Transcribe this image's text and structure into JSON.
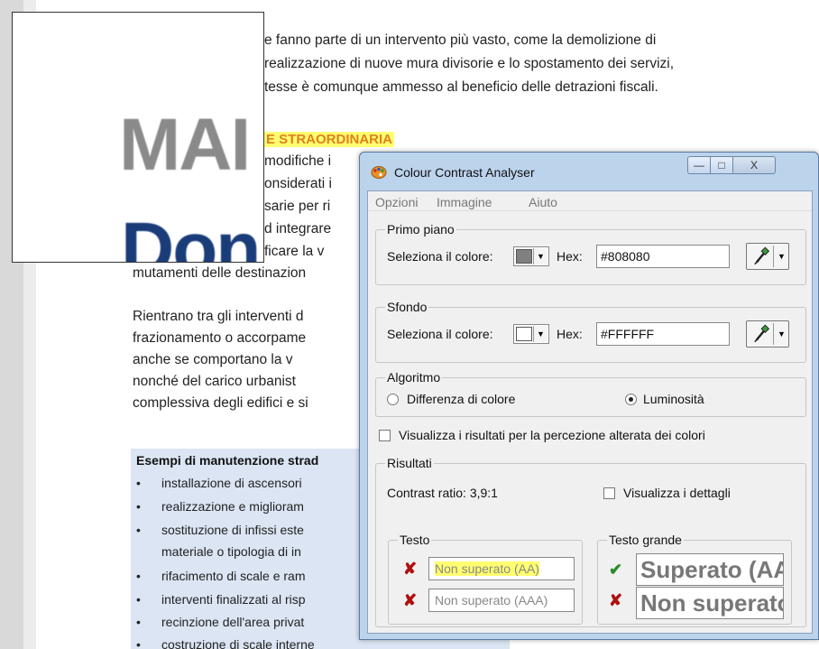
{
  "document": {
    "lines": [
      "e fanno parte di un intervento più vasto, come la demolizione di",
      "realizzazione di nuove mura divisorie e lo spostamento dei servizi,",
      "tesse è comunque ammesso al beneficio delle detrazioni fiscali.",
      "E STRAORDINARIA",
      "modifiche i",
      "onsiderati i",
      "sarie per ri",
      "d integrare",
      "ficare la v",
      "mutamenti delle destinazion",
      "Rientrano tra gli interventi d",
      "frazionamento o accorpame",
      "anche se comportano la v",
      "nonché del carico urbanist",
      "complessiva degli edifici e si"
    ],
    "esempi_title": "Esempi di manutenzione strad",
    "bullets": [
      "installazione di ascensori",
      "realizzazione e miglioram",
      "sostituzione di infissi este",
      "materiale o tipologia di in",
      "rifacimento di scale e ram",
      "interventi finalizzati al risp",
      "recinzione dell'area privat",
      "costruzione di scale interne"
    ],
    "bullet_char": "•"
  },
  "magnifier": {
    "text_top": "MAI",
    "text_bottom": "Don"
  },
  "dialog": {
    "title": "Colour Contrast Analyser",
    "window_buttons": {
      "minimize": "—",
      "maximize": "□",
      "close": "X"
    },
    "menu": [
      "Opzioni",
      "Immagine",
      "Aiuto"
    ],
    "foreground": {
      "group_label": "Primo piano",
      "select_label": "Seleziona il colore:",
      "hex_label": "Hex:",
      "hex_value": "#808080",
      "swatch_color": "#808080"
    },
    "background": {
      "group_label": "Sfondo",
      "select_label": "Seleziona il colore:",
      "hex_label": "Hex:",
      "hex_value": "#FFFFFF",
      "swatch_color": "#FFFFFF"
    },
    "algorithm": {
      "group_label": "Algoritmo",
      "option_1": "Differenza di colore",
      "option_2": "Luminosità",
      "selected": "Luminosità"
    },
    "altered_perception_label": "Visualizza i risultati per la percezione alterata dei colori",
    "results": {
      "group_label": "Risultati",
      "contrast_ratio": "Contrast ratio: 3,9:1",
      "details_label": "Visualizza i dettagli",
      "text_group_label": "Testo",
      "text_aa": "Non superato (AA)",
      "text_aaa": "Non superato (AAA)",
      "large_group_label": "Testo grande",
      "large_aa": "Superato (AA)",
      "large_aaa": "Non superato"
    },
    "marks": {
      "fail": "✘",
      "pass": "✔"
    }
  }
}
